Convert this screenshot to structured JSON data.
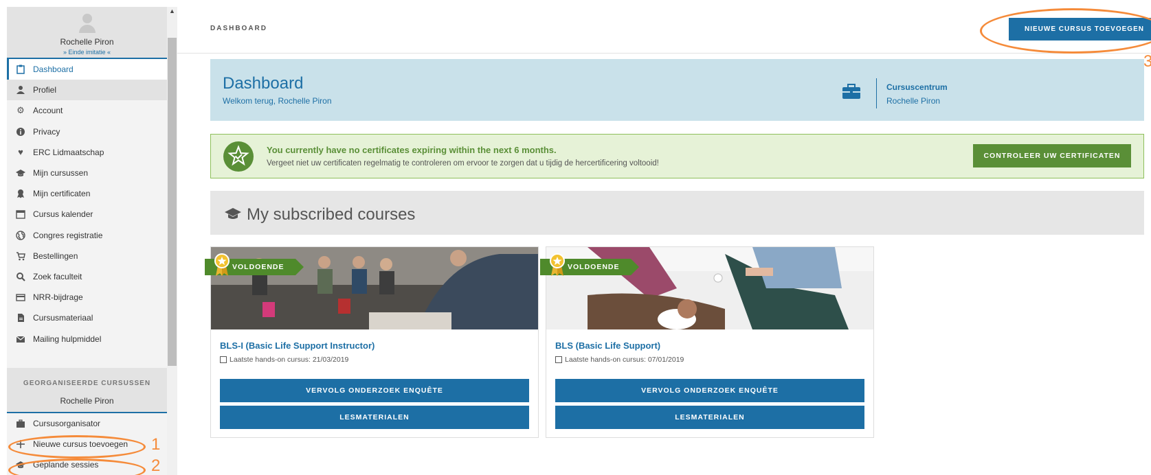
{
  "sidebar": {
    "profile": {
      "name": "Rochelle Piron",
      "stop_impersonation": "» Einde imitatie «"
    },
    "items": [
      {
        "label": "Dashboard",
        "icon": "clipboard-icon"
      },
      {
        "label": "Profiel",
        "icon": "user-icon"
      },
      {
        "label": "Account",
        "icon": "gear-icon"
      },
      {
        "label": "Privacy",
        "icon": "info-icon"
      },
      {
        "label": "ERC Lidmaatschap",
        "icon": "heart-icon"
      },
      {
        "label": "Mijn cursussen",
        "icon": "graduation-cap-icon"
      },
      {
        "label": "Mijn certificaten",
        "icon": "award-icon"
      },
      {
        "label": "Cursus kalender",
        "icon": "calendar-icon"
      },
      {
        "label": "Congres registratie",
        "icon": "globe-icon"
      },
      {
        "label": "Bestellingen",
        "icon": "cart-icon"
      },
      {
        "label": "Zoek faculteit",
        "icon": "search-icon"
      },
      {
        "label": "NRR-bijdrage",
        "icon": "card-icon"
      },
      {
        "label": "Cursusmateriaal",
        "icon": "document-icon"
      },
      {
        "label": "Mailing hulpmiddel",
        "icon": "envelope-icon"
      }
    ],
    "organised": {
      "heading": "GEORGANISEERDE CURSUSSEN",
      "name": "Rochelle Piron",
      "items": [
        {
          "label": "Cursusorganisator",
          "icon": "briefcase-icon"
        },
        {
          "label": "Nieuwe cursus toevoegen",
          "icon": "plus-icon"
        },
        {
          "label": "Geplande sessies",
          "icon": "graduation-cap-icon"
        }
      ]
    }
  },
  "header": {
    "breadcrumb": "DASHBOARD",
    "new_course_button": "NIEUWE CURSUS TOEVOEGEN"
  },
  "welcome": {
    "title": "Dashboard",
    "subtitle": "Welkom terug, Rochelle Piron",
    "center_label": "Cursuscentrum",
    "center_name": "Rochelle Piron"
  },
  "alert": {
    "message": "You currently have no certificates expiring within the next 6 months.",
    "submessage": "Vergeet niet uw certificaten regelmatig te controleren om ervoor te zorgen dat u tijdig de hercertificering voltooid!",
    "button": "CONTROLEER UW CERTIFICATEN"
  },
  "subscribed": {
    "heading": "My subscribed courses"
  },
  "courses": [
    {
      "badge": "VOLDOENDE",
      "title": "BLS-I (Basic Life Support Instructor)",
      "date": "Laatste hands-on cursus: 21/03/2019",
      "button_survey": "VERVOLG ONDERZOEK ENQUÊTE",
      "button_materials": "LESMATERIALEN"
    },
    {
      "badge": "VOLDOENDE",
      "title": "BLS (Basic Life Support)",
      "date": "Laatste hands-on cursus: 07/01/2019",
      "button_survey": "VERVOLG ONDERZOEK ENQUÊTE",
      "button_materials": "LESMATERIALEN"
    }
  ],
  "annotations": {
    "one": "1",
    "two": "2",
    "three": "3"
  },
  "colors": {
    "primary": "#1d6fa5",
    "success": "#5a8f37",
    "annotation": "#f58b3a",
    "banner": "#c9e1ea"
  }
}
